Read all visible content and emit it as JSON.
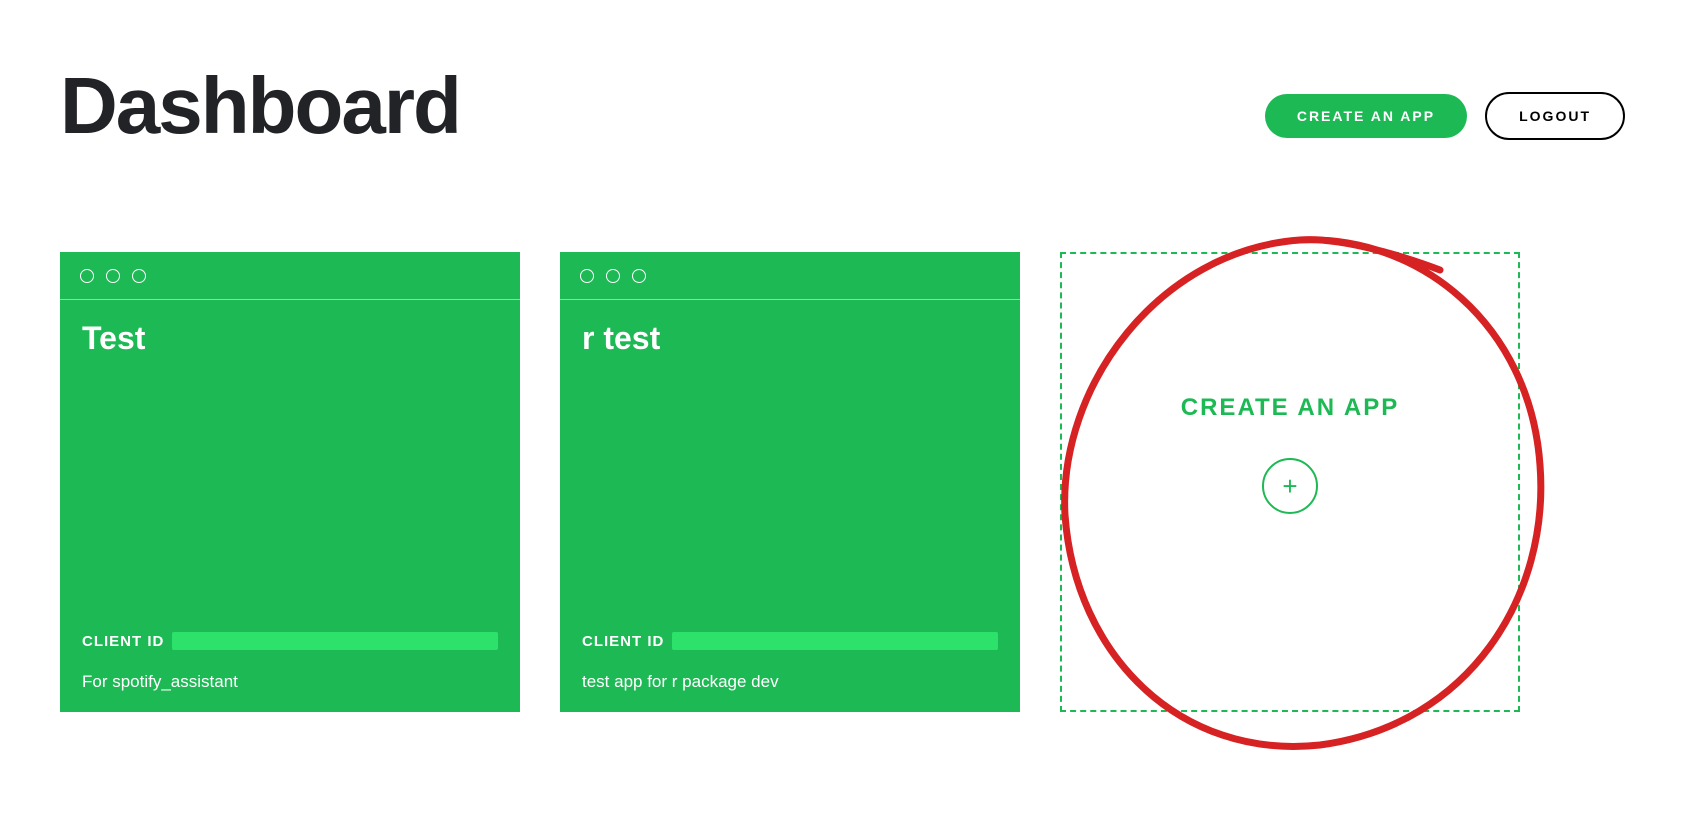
{
  "header": {
    "title": "Dashboard",
    "create_button": "CREATE AN APP",
    "logout_button": "LOGOUT"
  },
  "apps": [
    {
      "name": "Test",
      "client_id_label": "CLIENT ID",
      "description": "For spotify_assistant"
    },
    {
      "name": "r test",
      "client_id_label": "CLIENT ID",
      "description": "test app for r package dev"
    }
  ],
  "create_card": {
    "label": "CREATE AN APP",
    "plus": "+"
  }
}
